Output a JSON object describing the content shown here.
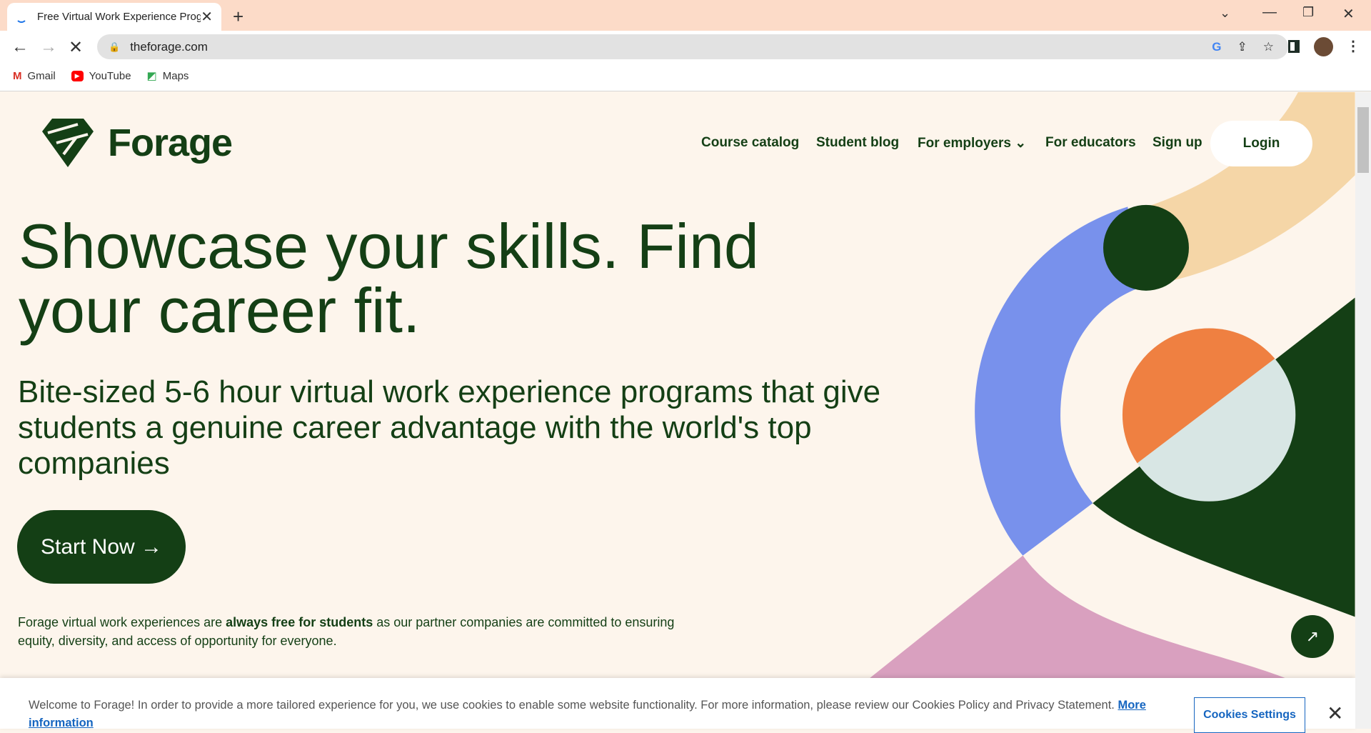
{
  "browser": {
    "tab_title": "Free Virtual Work Experience Programs",
    "url": "theforage.com",
    "bookmarks": [
      {
        "label": "Gmail",
        "icon": "gmail-icon"
      },
      {
        "label": "YouTube",
        "icon": "youtube-icon"
      },
      {
        "label": "Maps",
        "icon": "maps-icon"
      }
    ]
  },
  "header": {
    "logo": "Forage",
    "nav": [
      "Course catalog",
      "Student blog",
      "For employers",
      "For educators",
      "Sign up"
    ],
    "login": "Login"
  },
  "hero": {
    "headline": "Showcase your skills. Find your career fit.",
    "subtitle": "Bite-sized 5-6 hour virtual work experience programs that give students a genuine career advantage with the world's top companies",
    "cta": "Start Now →",
    "fine_pre": "Forage virtual work experiences are ",
    "fine_bold": "always free for students",
    "fine_post": " as our partner companies are committed to ensuring equity, diversity, and access of opportunity for everyone."
  },
  "cookie": {
    "text": "Welcome to Forage! In order to provide a more tailored experience for you, we use cookies to enable some website functionality. For more information, please review our Cookies Policy and Privacy Statement. ",
    "link": "More information",
    "settings": "Cookies Settings"
  },
  "colors": {
    "brand": "#143f15",
    "background": "#fdf5ec",
    "blue": "#7891ec",
    "peach": "#f5d6a7",
    "orange": "#ef8041",
    "pink": "#d9a0bf",
    "pale": "#d8e6e4"
  }
}
